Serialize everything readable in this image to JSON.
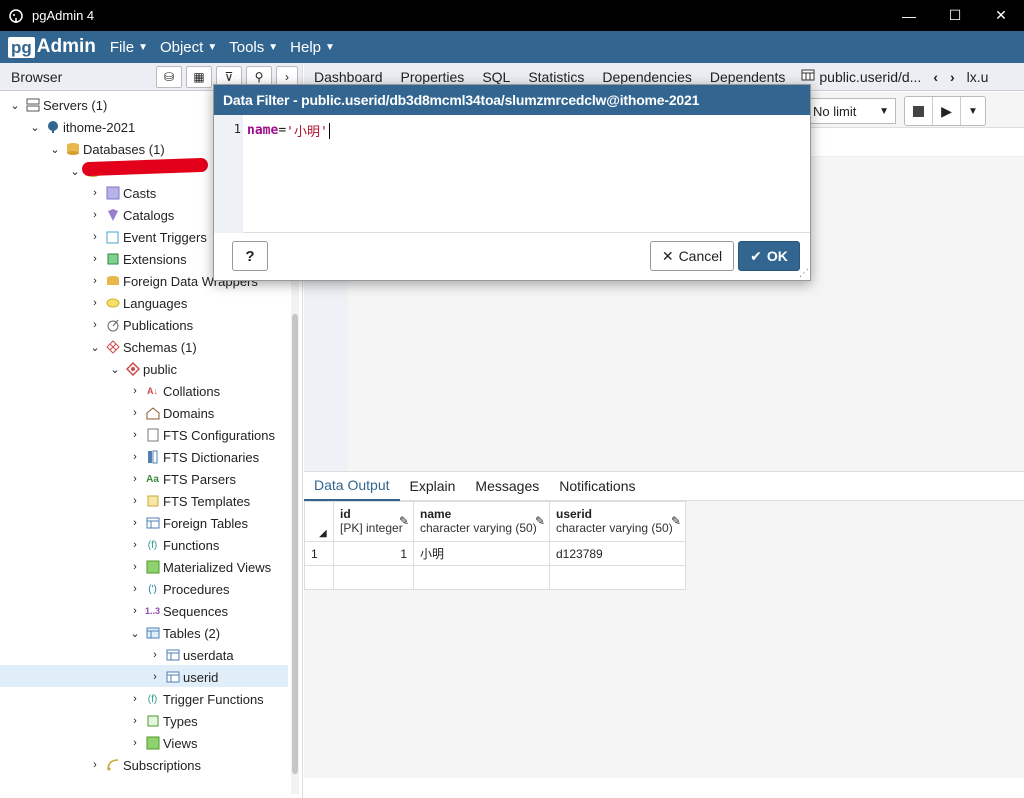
{
  "window": {
    "title": "pgAdmin 4",
    "minimize": "—",
    "maximize": "☐",
    "close": "✕"
  },
  "menu": {
    "logo_pg": "pg",
    "logo_admin": "Admin",
    "items": [
      {
        "label": "File"
      },
      {
        "label": "Object"
      },
      {
        "label": "Tools"
      },
      {
        "label": "Help"
      }
    ]
  },
  "browser": {
    "title": "Browser",
    "tree": [
      {
        "label": "Servers (1)"
      },
      {
        "label": "ithome-2021"
      },
      {
        "label": "Databases (1)"
      },
      {
        "label": ""
      },
      {
        "label": "Casts"
      },
      {
        "label": "Catalogs"
      },
      {
        "label": "Event Triggers"
      },
      {
        "label": "Extensions"
      },
      {
        "label": "Foreign Data Wrappers"
      },
      {
        "label": "Languages"
      },
      {
        "label": "Publications"
      },
      {
        "label": "Schemas (1)"
      },
      {
        "label": "public"
      },
      {
        "label": "Collations"
      },
      {
        "label": "Domains"
      },
      {
        "label": "FTS Configurations"
      },
      {
        "label": "FTS Dictionaries"
      },
      {
        "label": "FTS Parsers"
      },
      {
        "label": "FTS Templates"
      },
      {
        "label": "Foreign Tables"
      },
      {
        "label": "Functions"
      },
      {
        "label": "Materialized Views"
      },
      {
        "label": "Procedures"
      },
      {
        "label": "Sequences"
      },
      {
        "label": "Tables (2)"
      },
      {
        "label": "userdata"
      },
      {
        "label": "userid"
      },
      {
        "label": "Trigger Functions"
      },
      {
        "label": "Types"
      },
      {
        "label": "Views"
      },
      {
        "label": "Subscriptions"
      }
    ]
  },
  "tabs": {
    "items": [
      "Dashboard",
      "Properties",
      "SQL",
      "Statistics",
      "Dependencies",
      "Dependents"
    ],
    "active": "public.userid/d...",
    "nav_prev": "‹",
    "nav_next": "›",
    "extra": "lx.u"
  },
  "query_toolbar": {
    "limit": "No limit"
  },
  "results": {
    "tabs": [
      "Data Output",
      "Explain",
      "Messages",
      "Notifications"
    ],
    "columns": [
      {
        "name": "id",
        "type": "[PK] integer"
      },
      {
        "name": "name",
        "type": "character varying (50)"
      },
      {
        "name": "userid",
        "type": "character varying (50)"
      }
    ],
    "rows": [
      {
        "row_no": "1",
        "id": "1",
        "name": "小明",
        "userid": "d123789"
      }
    ]
  },
  "dialog": {
    "title": "Data Filter - public.userid/db3d8mcml34toa/slumzmrcedclw@ithome-2021",
    "line_number": "1",
    "code_keyword": "name",
    "code_operator": "=",
    "code_string": "'小明'",
    "help_label": "?",
    "cancel_label": "Cancel",
    "ok_label": "OK"
  }
}
